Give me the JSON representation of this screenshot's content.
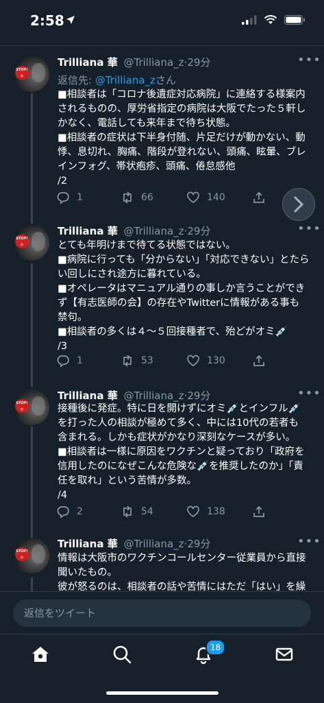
{
  "status": {
    "time": "2:58"
  },
  "tweets": [
    {
      "name": "Trilliana 華",
      "handle": "@Trilliana_z",
      "age": "29分",
      "reply_prefix": "返信先: ",
      "reply_mention": "@Trilliana_z",
      "reply_suffix": "さん",
      "text": "■相談者は「コロナ後遺症対応病院」に連絡する様案内\nされるものの、厚労省指定の病院は大阪でたった５軒し\nかなく、電話しても来年まで待ち状態。\n■相談者の症状は下半身付随、片足だけが動かない、動\n悸、息切れ、胸痛、階段が登れない、頭痛、眩暈、ブレ\nインフォグ、帯状疱疹、頭痛、倦怠感他\n/2",
      "replies": "1",
      "retweets": "66",
      "likes": "140"
    },
    {
      "name": "Trilliana 華",
      "handle": "@Trilliana_z",
      "age": "29分",
      "text": "とても年明けまで待てる状態ではない。\n■病院に行っても「分からない」「対応できない」とたら\nい回しにされ途方に暮れている。\n■オペレータはマニュアル通りの事しか言うことができ\nず【有志医師の会】の存在やTwitterに情報がある事も\n禁句。\n■相談者の多くは４〜５回接種者で、殆どがオミ💉\n/3",
      "replies": "1",
      "retweets": "53",
      "likes": "130"
    },
    {
      "name": "Trilliana 華",
      "handle": "@Trilliana_z",
      "age": "29分",
      "text": "接種後に発症。特に日を開けずにオミ💉とインフル💉\nを打った人の相談が極めて多く、中には10代の若者も\n含まれる。しかも症状がかなり深刻なケースが多い。\n■相談者は一様に原因をワクチンと疑っており「政府を\n信用したのになぜこんな危険な💉を推奨したのか」「責\n任を取れ」という苦情が多数。\n/4",
      "replies": "2",
      "retweets": "54",
      "likes": "138"
    },
    {
      "name": "Trilliana 華",
      "handle": "@Trilliana_z",
      "age": "29分",
      "text": "情報は大阪市のワクチンコールセンター従業員から直接\n聞いたもの。\n彼が怒るのは、相談者の話や苦情にはただ「はい」を繰"
    }
  ],
  "composer": {
    "placeholder": "返信をツイート"
  },
  "tabbar": {
    "notifications_badge": "18"
  },
  "avatar_badge": "STOP!",
  "colors": {
    "background": "#15202b",
    "accent": "#1d9bf0",
    "muted": "#8899a6"
  }
}
